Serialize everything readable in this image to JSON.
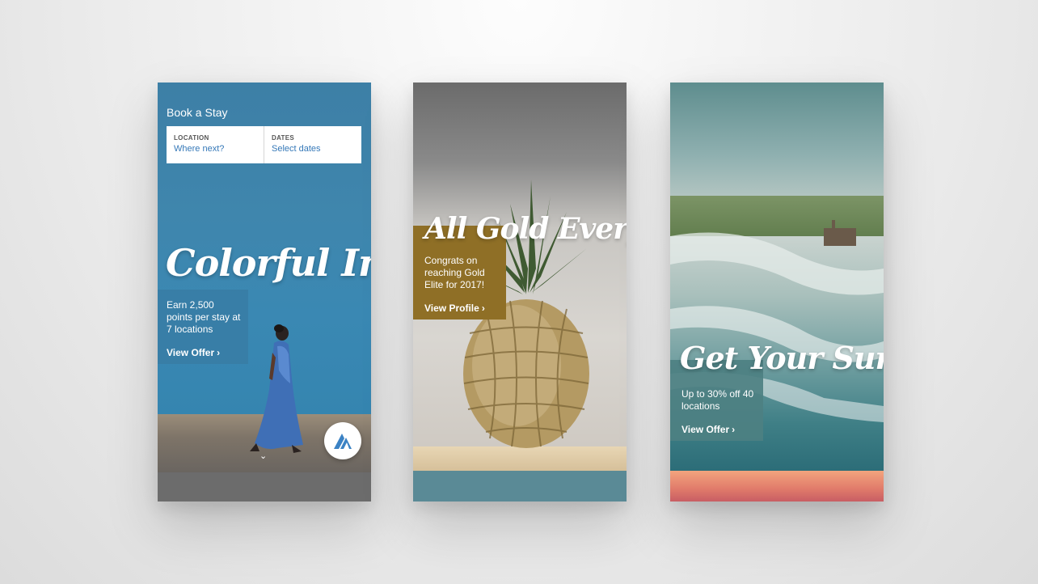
{
  "phone1": {
    "header": {
      "title": "Book a Stay"
    },
    "search": {
      "location_label": "LOCATION",
      "location_value": "Where next?",
      "dates_label": "DATES",
      "dates_value": "Select dates"
    },
    "promo": {
      "headline": "Colorful India",
      "description": "Earn 2,500 points per stay at 7 locations",
      "cta": "View Offer"
    }
  },
  "phone2": {
    "promo": {
      "headline": "All Gold Everything",
      "description": "Congrats on reaching Gold Elite for 2017!",
      "cta": "View Profile"
    }
  },
  "phone3": {
    "promo": {
      "headline": "Get Your Surf On",
      "description": "Up to 30% off 40 locations",
      "cta": "View Offer"
    }
  },
  "icons": {
    "chevron_right": "chevron-right-icon",
    "chevron_down": "chevron-down-icon",
    "brand": "marriott-logo-icon"
  },
  "colors": {
    "link_blue": "#3578b8",
    "india_blue": "#3d7fa6",
    "gold": "#8f6f26",
    "teal": "#4d8082"
  }
}
